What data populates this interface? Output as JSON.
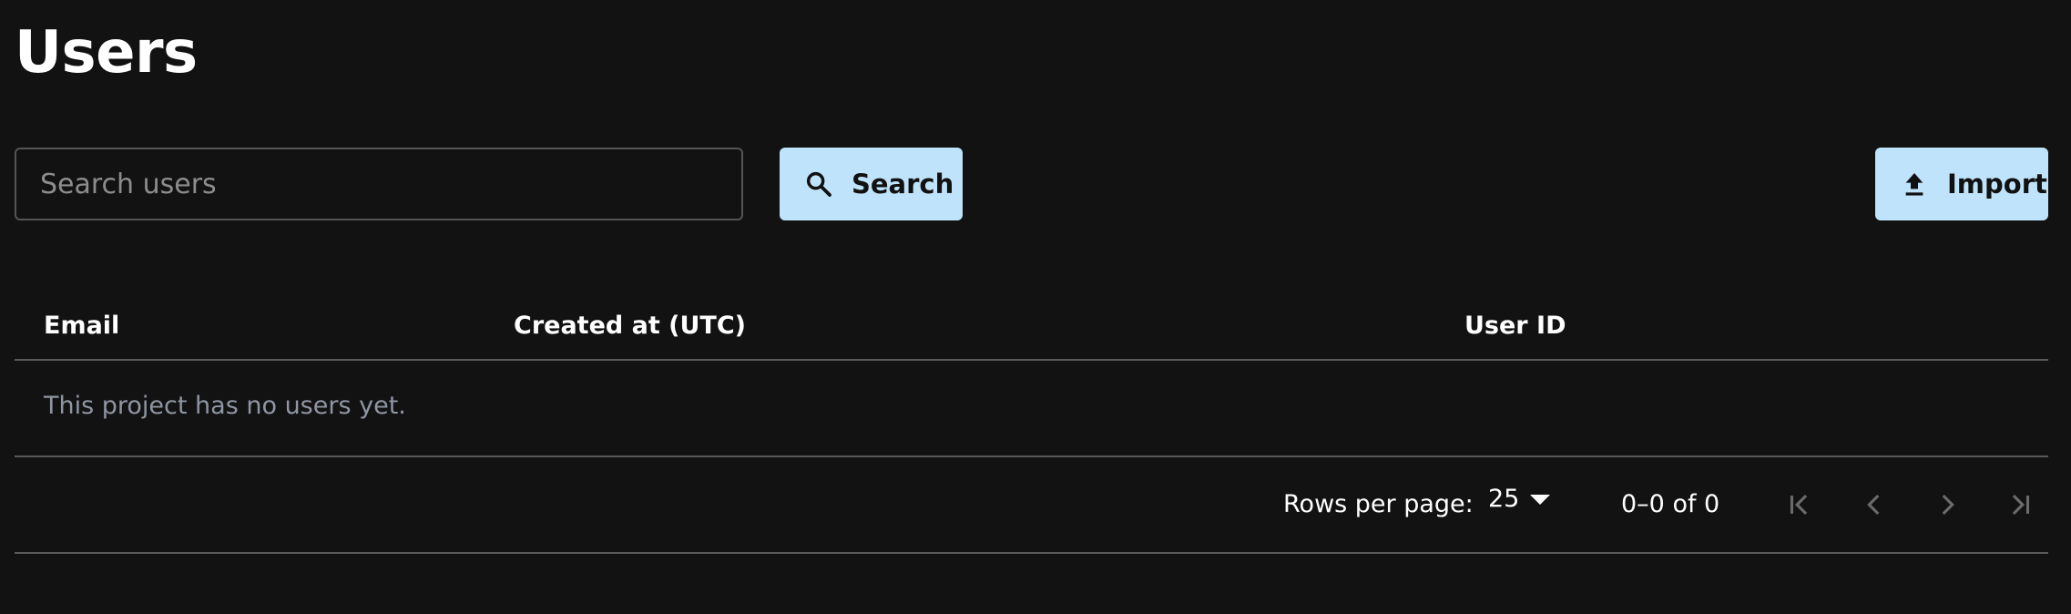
{
  "header": {
    "title": "Users"
  },
  "toolbar": {
    "search_placeholder": "Search users",
    "search_value": "",
    "search_label": "Search",
    "import_label": "Import"
  },
  "table": {
    "columns": [
      "Email",
      "Created at (UTC)",
      "User ID"
    ],
    "empty_message": "This project has no users yet."
  },
  "pagination": {
    "rows_per_page_label": "Rows per page:",
    "rows_per_page_value": "25",
    "range_text": "0–0 of 0"
  },
  "colors": {
    "background": "#121212",
    "button_bg": "#bfe3fb",
    "muted_text": "#8f96a3",
    "divider": "#5a5a5a"
  }
}
